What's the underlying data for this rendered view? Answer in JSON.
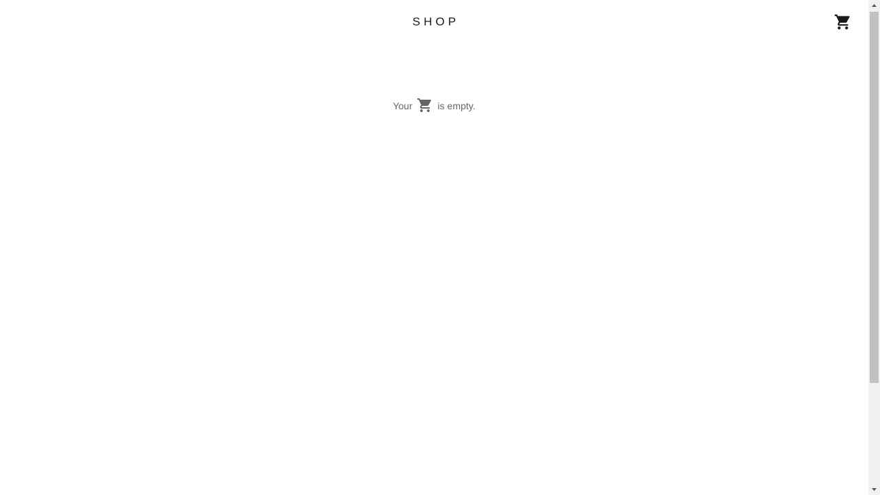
{
  "header": {
    "brand": "SHOP",
    "cart_icon": "shopping-cart-icon"
  },
  "main": {
    "empty_prefix": "Your",
    "empty_icon": "shopping-cart-icon",
    "empty_suffix": "is empty."
  },
  "colors": {
    "text_dark": "#1a1a1a",
    "text_muted": "#666666",
    "background": "#ffffff",
    "scrollbar_track": "#f1f1f1",
    "scrollbar_thumb": "#c1c1c1"
  }
}
